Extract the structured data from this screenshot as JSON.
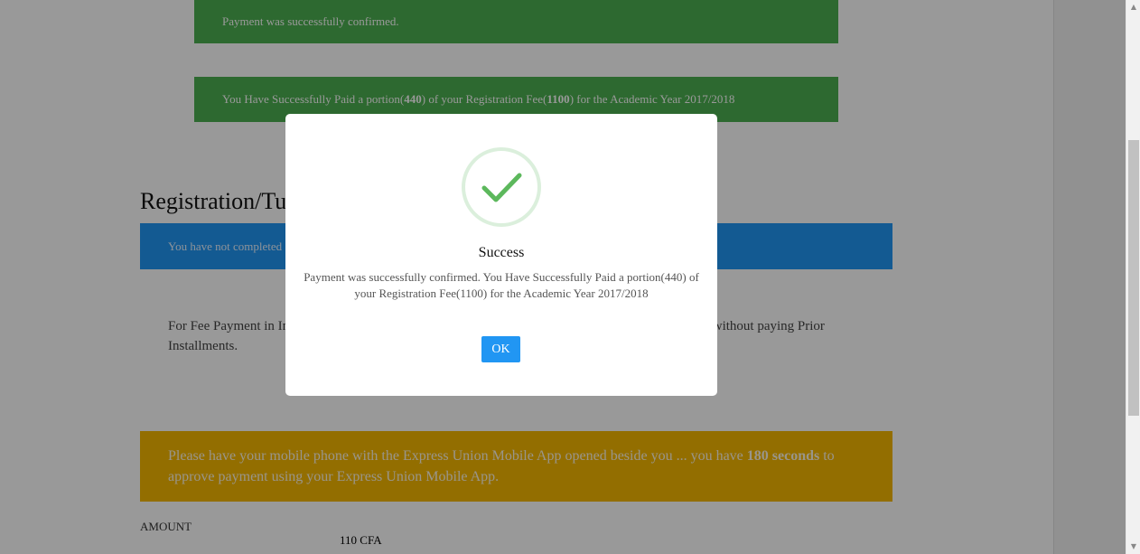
{
  "alerts": {
    "confirmed": "Payment was successfully confirmed.",
    "paid_prefix": "You Have Successfully Paid a portion(",
    "paid_portion": "440",
    "paid_middle": ") of your Registration Fee(",
    "paid_fee": "1100",
    "paid_suffix": ") for the Academic Year 2017/2018"
  },
  "section": {
    "heading": "Registration/Tu",
    "notice": "You have not completed",
    "info_left_line1": "For Fee Payment in In",
    "info_right_line1": ") without paying Prior",
    "info_line2": "Installments."
  },
  "instruction": {
    "prefix": "Please have your mobile phone with the Express Union Mobile App opened beside you ... you have ",
    "seconds": "180 seconds",
    "suffix": " to approve payment using your Express Union Mobile App."
  },
  "amount": {
    "label": "AMOUNT",
    "value": "110 CFA"
  },
  "modal": {
    "title": "Success",
    "message": "Payment was successfully confirmed. You Have Successfully Paid a portion(440) of your Registration Fee(1100) for the Academic Year 2017/2018",
    "ok_label": "OK"
  },
  "icons": {
    "success": "check-icon",
    "scroll_up": "scroll-up-arrow-icon",
    "scroll_down": "scroll-down-arrow-icon"
  },
  "colors": {
    "success_green": "#4caf50",
    "info_blue": "#2196f3",
    "warning_yellow": "#f5b800"
  }
}
